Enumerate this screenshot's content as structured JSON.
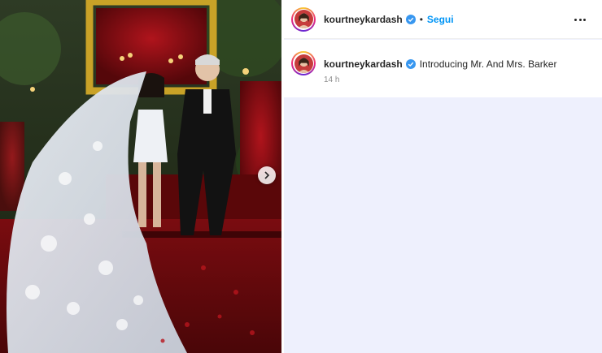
{
  "post": {
    "username": "kourtneykardash",
    "separator": "•",
    "follow_label": "Segui",
    "more_icon": "more-options-icon"
  },
  "caption": {
    "username": "kourtneykardash",
    "text": "Introducing Mr. And Mrs. Barker",
    "time_ago": "14 h"
  },
  "colors": {
    "follow_blue": "#0095f6",
    "verified_blue": "#3897f0",
    "side_background": "#eef0fd"
  }
}
